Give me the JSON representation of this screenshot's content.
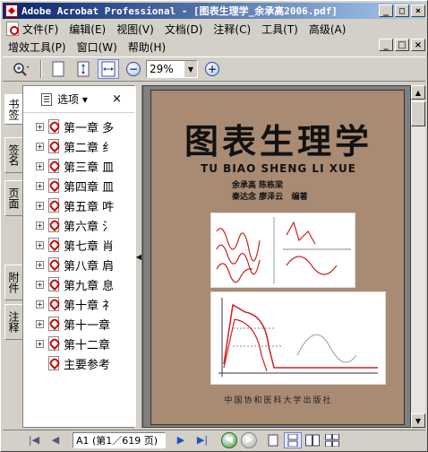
{
  "window": {
    "title": "Adobe Acrobat Professional - [图表生理学_余承高2006.pdf]",
    "buttons": {
      "minimize": "_",
      "maximize": "□",
      "close": "×"
    }
  },
  "menu": {
    "row1": [
      "文件(F)",
      "编辑(E)",
      "视图(V)",
      "文档(D)",
      "注释(C)",
      "工具(T)",
      "高级(A)"
    ],
    "row2": [
      "增效工具(P)",
      "窗口(W)",
      "帮助(H)"
    ]
  },
  "toolbar": {
    "zoom_value": "29%"
  },
  "side_tabs": [
    "书签",
    "签名",
    "页面",
    "附件",
    "注释"
  ],
  "panel": {
    "options_label": "选项",
    "dropdown_arrow": "▾",
    "close_symbol": "×",
    "bookmarks": [
      {
        "label": "第一章 多",
        "expandable": true
      },
      {
        "label": "第二章 纟",
        "expandable": true
      },
      {
        "label": "第三章 皿",
        "expandable": true
      },
      {
        "label": "第四章 皿",
        "expandable": true
      },
      {
        "label": "第五章 吽",
        "expandable": true
      },
      {
        "label": "第六章 氵",
        "expandable": true
      },
      {
        "label": "第七章 肖",
        "expandable": true
      },
      {
        "label": "第八章 肩",
        "expandable": true
      },
      {
        "label": "第九章 息",
        "expandable": true
      },
      {
        "label": "第十章 礻",
        "expandable": true
      },
      {
        "label": "第十一章",
        "expandable": true
      },
      {
        "label": "第十二章",
        "expandable": true
      },
      {
        "label": "主要参考",
        "expandable": false
      }
    ]
  },
  "document": {
    "title": "图表生理学",
    "pinyin": "TU BIAO SHENG LI XUE",
    "authors_line1": "余承高    陈栋梁",
    "authors_line2": "秦达念    廖泽云",
    "editor_mark": "编著",
    "publisher": "中国协和医科大学出版社"
  },
  "status": {
    "page_indicator": "A1 (第1／619 页)"
  }
}
